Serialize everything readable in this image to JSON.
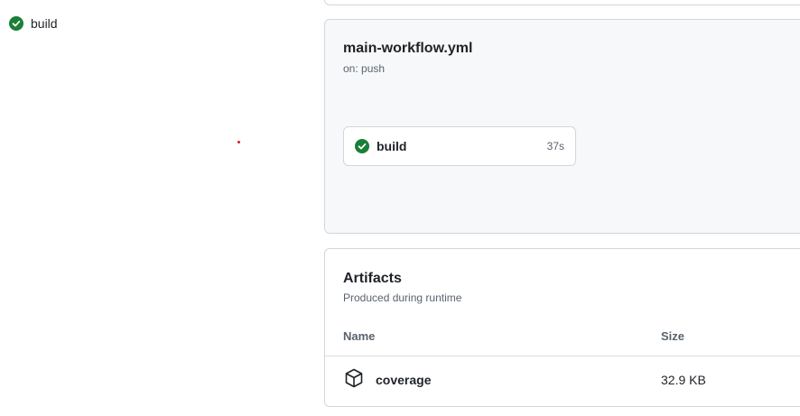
{
  "sidebar": {
    "job": {
      "label": "build",
      "status": "success",
      "icon": "check-circle-icon"
    }
  },
  "workflow": {
    "file_name": "main-workflow.yml",
    "trigger": "on: push",
    "jobs": [
      {
        "name": "build",
        "duration": "37s",
        "status": "success",
        "icon": "check-circle-icon"
      }
    ]
  },
  "artifacts": {
    "title": "Artifacts",
    "subtitle": "Produced during runtime",
    "columns": {
      "name": "Name",
      "size": "Size"
    },
    "items": [
      {
        "name": "coverage",
        "size": "32.9 KB",
        "icon": "package-icon"
      }
    ]
  },
  "colors": {
    "success": "#1a7f37",
    "border": "#d0d7de",
    "panel_bg": "#f6f8fa",
    "muted_text": "#59636e",
    "cursor_dot": "#cf222e"
  }
}
